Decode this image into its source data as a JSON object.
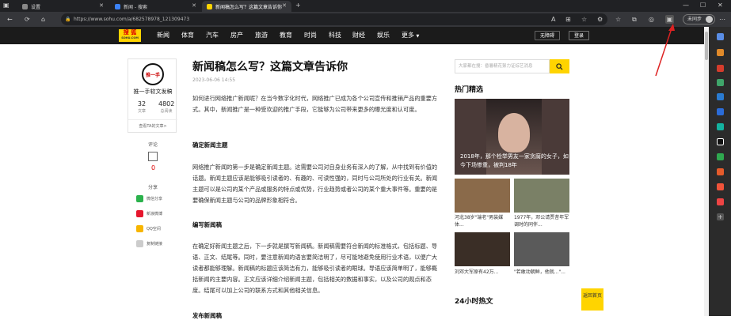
{
  "browser": {
    "tabs": [
      {
        "label": "设置",
        "icon": "gear-icon"
      },
      {
        "label": "新闻 - 搜索",
        "icon": "search-icon"
      },
      {
        "label": "新闻稿怎么写？这篇文章告诉你",
        "icon": "sohu-icon"
      }
    ],
    "url": "https://www.sohu.com/a/682578978_121309473",
    "sync_label": "未同步"
  },
  "site": {
    "logo_top": "搜 狐",
    "logo_bottom": "SOHU.COM",
    "nav": [
      "新闻",
      "体育",
      "汽车",
      "房产",
      "旅游",
      "教育",
      "时尚",
      "科技",
      "财经",
      "娱乐",
      "更多"
    ],
    "btn_dark": "无障碍",
    "btn_login": "登录"
  },
  "author": {
    "logo_text": "推一手",
    "name": "推一手软文发稿",
    "articles_count": "32",
    "articles_label": "文章",
    "reads_count": "4802",
    "reads_label": "总阅读",
    "view_link": "查看TA的文章>"
  },
  "comments": {
    "label": "评论",
    "count": "0"
  },
  "share": {
    "label": "分享",
    "items": [
      "微信分享",
      "新浪微博",
      "QQ空间",
      "复制链接"
    ]
  },
  "article": {
    "title": "新闻稿怎么写？这篇文章告诉你",
    "date": "2023-06-06 14:55",
    "p1": "如何进行网络推广新闻呢？在当今数字化时代，网络推广已成为各个公司宣传和推销产品的重要方式。其中，新闻推广是一种受欢迎的推广手段，它能够为公司带来更多的曝光度和认可度。",
    "h1": "确定新闻主题",
    "p2": "网络推广新闻的第一步是确定新闻主题。这需要公司对自身业务有深入的了解，从中找到有价值的话题。新闻主题应该是能够吸引读者的、有趣的、可读性强的，同时与公司所处的行业有关。新闻主题可以是公司的某个产品或服务的特点或优势，行业趋势或者公司的某个重大事件等。重要的是要确保新闻主题与公司的品牌形象相符合。",
    "h2": "编写新闻稿",
    "p3": "在确定好新闻主题之后，下一步就是撰写新闻稿。新闻稿需要符合新闻的标准格式，包括标题、导语、正文、结尾等。同时，要注意新闻的语言要简洁明了，尽可能地避免使用行业术语，以便广大读者都能够理解。新闻稿的标题应该简洁有力，能够吸引读者的眼球。导语应该简单明了，能够概括新闻的主要内容。正文应该详细介绍新闻主题，包括相关的数据和事实，以及公司的观点和态度。结尾可以加上公司的联系方式和其他相关信息。",
    "h3": "发布新闻稿"
  },
  "right": {
    "search_placeholder": "大家都在搜：昏暑精花絮力证综艺消息",
    "hot_title": "热门精选",
    "hot_main_caption": "2018年，那个检举男友一家贪腐的女子，如今下场惨重，被判18年",
    "thumbs": [
      {
        "caption": "河北38岁\"端老\"男装媒体..."
      },
      {
        "caption": "1977年，邓公请贾昔年军调时的同伴..."
      },
      {
        "caption": "刘邓大军原有42万..."
      },
      {
        "caption": "\"若敢动朝鲜，他就...\"..."
      }
    ],
    "hot24_title": "24小时热文",
    "back_top": "返回首页"
  }
}
